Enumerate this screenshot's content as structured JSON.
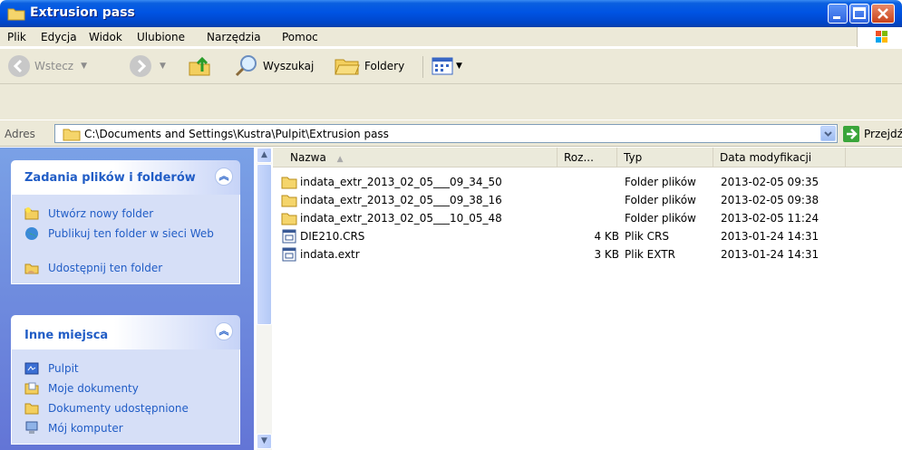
{
  "window": {
    "title": "Extrusion pass"
  },
  "menu": [
    "Plik",
    "Edycja",
    "Widok",
    "Ulubione",
    "Narzędzia",
    "Pomoc"
  ],
  "toolbar": {
    "back_label": "Wstecz",
    "search_label": "Wyszukaj",
    "folders_label": "Foldery"
  },
  "address": {
    "label": "Adres",
    "path": "C:\\Documents and Settings\\Kustra\\Pulpit\\Extrusion pass",
    "go_label": "Przejdź"
  },
  "tasks_panel": {
    "title": "Zadania plików i folderów",
    "items": [
      "Utwórz nowy folder",
      "Publikuj ten folder w sieci Web",
      "Udostępnij ten folder"
    ]
  },
  "places_panel": {
    "title": "Inne miejsca",
    "items": [
      "Pulpit",
      "Moje dokumenty",
      "Dokumenty udostępnione",
      "Mój komputer"
    ]
  },
  "columns": {
    "name": "Nazwa",
    "size": "Roz...",
    "type": "Typ",
    "date": "Data modyfikacji"
  },
  "files": [
    {
      "name": "indata_extr_2013_02_05___09_34_50",
      "size": "",
      "type": "Folder plików",
      "date": "2013-02-05 09:35",
      "icon": "folder-icon"
    },
    {
      "name": "indata_extr_2013_02_05___09_38_16",
      "size": "",
      "type": "Folder plików",
      "date": "2013-02-05 09:38",
      "icon": "folder-icon"
    },
    {
      "name": "indata_extr_2013_02_05___10_05_48",
      "size": "",
      "type": "Folder plików",
      "date": "2013-02-05 11:24",
      "icon": "folder-icon"
    },
    {
      "name": "DIE210.CRS",
      "size": "4 KB",
      "type": "Plik CRS",
      "date": "2013-01-24 14:31",
      "icon": "file-icon"
    },
    {
      "name": "indata.extr",
      "size": "3 KB",
      "type": "Plik EXTR",
      "date": "2013-01-24 14:31",
      "icon": "file-icon"
    }
  ],
  "colors": {
    "titlebar": "#0054e3",
    "taskpane": "#6375d6",
    "link": "#215dc6"
  }
}
